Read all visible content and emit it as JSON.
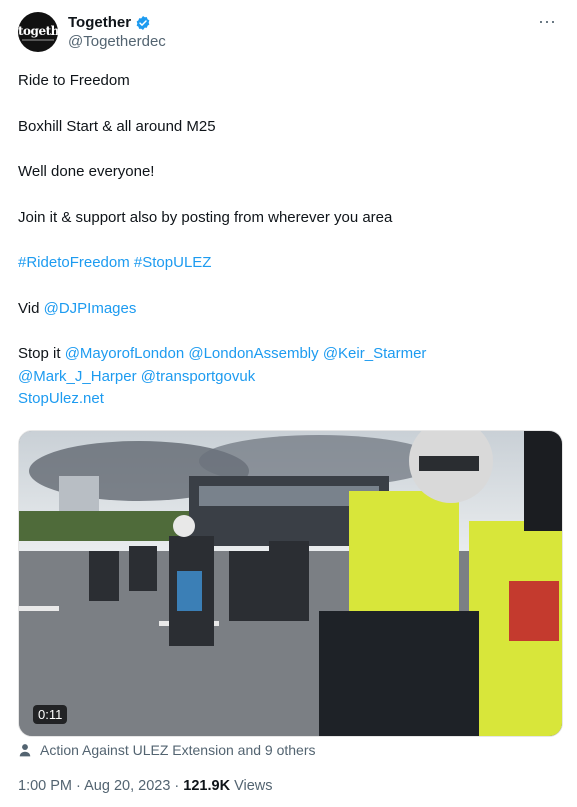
{
  "author": {
    "display_name": "Together",
    "handle": "@Togetherdec",
    "avatar_text": "togethe"
  },
  "more_label": "···",
  "tweet": {
    "line1": "Ride to Freedom",
    "line2": "Boxhill Start & all around M25",
    "line3": "Well done everyone!",
    "line4": "Join it & support also by posting from wherever you area",
    "hashtag1": "#RidetoFreedom",
    "hashtag2": "#StopULEZ",
    "vid_prefix": "Vid",
    "vid_mention": "@DJPImages",
    "stop_prefix": "Stop it",
    "mention1": "@MayorofLondon",
    "mention2": "@LondonAssembly",
    "mention3": "@Keir_Starmer",
    "mention4": "@Mark_J_Harper",
    "mention5": "@transportgovuk",
    "link": "StopUlez.net"
  },
  "media": {
    "duration": "0:11"
  },
  "tagged": {
    "text": "Action Against ULEZ Extension and 9 others"
  },
  "meta": {
    "time": "1:00 PM",
    "date": "Aug 20, 2023",
    "separator": "·",
    "views_count": "121.9K",
    "views_label": "Views"
  },
  "colors": {
    "link": "#1d9bf0",
    "secondary_text": "#536471",
    "verified": "#1d9bf0"
  }
}
